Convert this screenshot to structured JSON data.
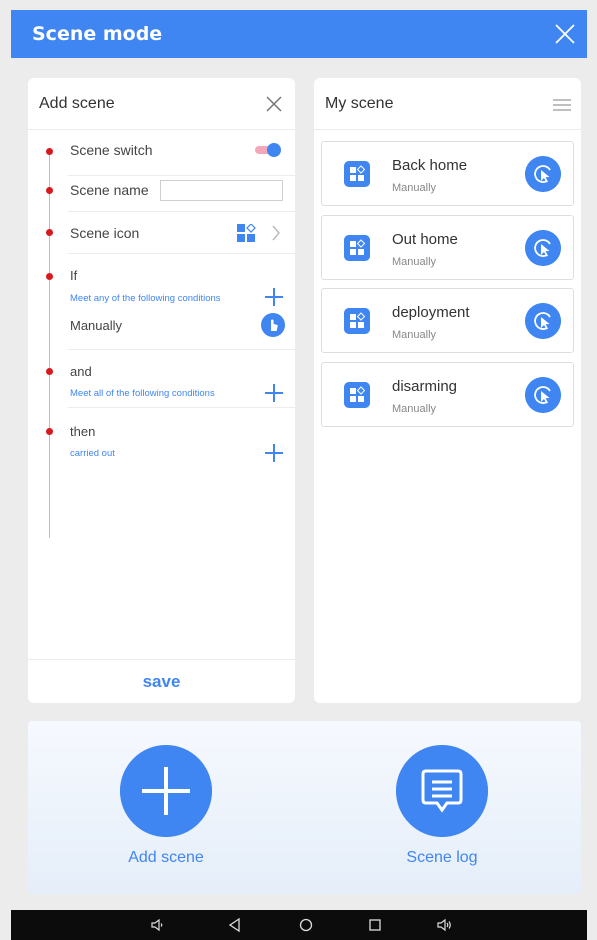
{
  "header": {
    "title": "Scene mode"
  },
  "add_scene": {
    "title": "Add scene",
    "switch_label": "Scene switch",
    "switch_on": true,
    "name_label": "Scene name",
    "name_value": "",
    "icon_label": "Scene icon",
    "if_label": "If",
    "if_sub": "Meet any of the following conditions",
    "if_condition": "Manually",
    "and_label": "and",
    "and_sub": "Meet all of the following conditions",
    "then_label": "then",
    "then_sub": "carried out",
    "save_label": "save"
  },
  "my_scene": {
    "title": "My scene",
    "items": [
      {
        "name": "Back home",
        "mode": "Manually"
      },
      {
        "name": "Out home",
        "mode": "Manually"
      },
      {
        "name": "deployment",
        "mode": "Manually"
      },
      {
        "name": "disarming",
        "mode": "Manually"
      }
    ]
  },
  "bottom": {
    "add_label": "Add scene",
    "log_label": "Scene log"
  },
  "colors": {
    "accent": "#3f86f2",
    "dot": "#d7191c",
    "toggle_track": "#f4a7b9"
  },
  "icons": [
    "close-icon",
    "menu-icon",
    "scene-icon",
    "chevron-right-icon",
    "plus-icon",
    "hand-pointer-icon",
    "cursor-click-icon",
    "message-log-icon",
    "volume-down-icon",
    "back-icon",
    "home-icon",
    "recents-icon",
    "volume-up-icon"
  ]
}
